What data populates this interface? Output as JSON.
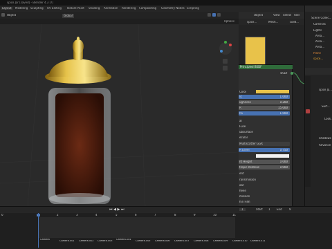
{
  "window": {
    "title": "spice Jar [saved] - Blender 4.3 [?]"
  },
  "workspaces": [
    "Layout",
    "Modeling",
    "Sculpting",
    "UV Editing",
    "Texture Paint",
    "Shading",
    "Animation",
    "Rendering",
    "Compositing",
    "Geometry Nodes",
    "Scripting"
  ],
  "header": {
    "mode": "Object",
    "view": "Global",
    "viewport_options": "Options"
  },
  "shader_editor": {
    "mode": "Object",
    "menus": [
      "View",
      "Select",
      "Add"
    ],
    "breadcrumb": [
      "spice...",
      "Mesh...",
      "Gold..."
    ],
    "node_title": "Principled BSDF",
    "output_label": "BSDF",
    "rows": [
      {
        "label": "Color",
        "value": ""
      },
      {
        "label": "lic",
        "value": "1.000"
      },
      {
        "label": "ughness",
        "value": "0.200"
      },
      {
        "label": "R",
        "value": "15.000"
      },
      {
        "label": "ha",
        "value": "1.000"
      },
      {
        "label": "al",
        "value": ""
      },
      {
        "label": "Fuse",
        "value": ""
      },
      {
        "label": "ubsurface",
        "value": ""
      },
      {
        "label": "ecular",
        "value": ""
      },
      {
        "label": "Multiscatter GGX",
        "value": ""
      },
      {
        "label": "R Level",
        "value": "0.750"
      },
      {
        "label": "",
        "value": ""
      },
      {
        "label": "nt Height",
        "value": "0.000"
      },
      {
        "label": "tropic Rotation",
        "value": "0.000"
      },
      {
        "label": "ent",
        "value": ""
      },
      {
        "label": "ransmission",
        "value": ""
      },
      {
        "label": "oat",
        "value": ""
      },
      {
        "label": "heen",
        "value": ""
      },
      {
        "label": "mission",
        "value": ""
      },
      {
        "label": "hin Film",
        "value": ""
      }
    ]
  },
  "outliner": {
    "items": [
      "Scene Collec...",
      "Cameras",
      "Lights",
      "Area...",
      "Area...",
      "Area...",
      "Plane",
      "spice..."
    ]
  },
  "properties": {
    "object_name": "spice Ja...",
    "labels": [
      "Surf...",
      "Look...",
      "Shadows",
      "Advance"
    ]
  },
  "timeline": {
    "frames": [
      "0",
      "1",
      "2",
      "3",
      "4",
      "5",
      "6",
      "7",
      "8",
      "9",
      "10",
      "11"
    ],
    "current": "1",
    "start_label": "Start",
    "start": "1",
    "end_label": "End",
    "end": "9",
    "markers": [
      "Camera",
      "Camera.001",
      "Camera.002",
      "Camera.003",
      "Camera.004",
      "Camera.005",
      "Camera.006",
      "Camera.007",
      "Camera.008",
      "Camera.009",
      "Camera.010",
      "Camera.011"
    ]
  },
  "colors": {
    "base_color": "#e8c24a",
    "node_header": "#2f6b3a",
    "accent": "#4772b3"
  }
}
